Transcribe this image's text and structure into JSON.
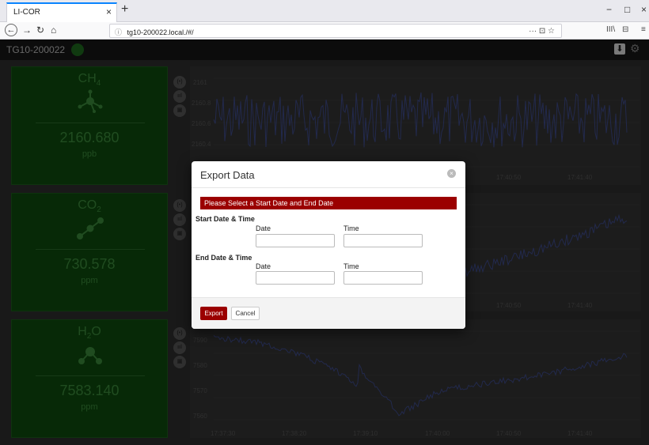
{
  "browser": {
    "tab_title": "LI-COR",
    "tab_close": "×",
    "new_tab": "+",
    "url": "tg10-200022.local./#/",
    "url_info_icon": "info-icon",
    "url_actions": "···  ⊡  ☆",
    "library": "III\\",
    "sidebar_toggle": "⊟",
    "menu": "≡",
    "win_min": "−",
    "win_max": "□",
    "win_close": "×"
  },
  "app": {
    "title": "TG10-200022",
    "status_color": "#1e6a1e",
    "download_icon": "⬇",
    "settings_icon": "⚙"
  },
  "cards": [
    {
      "gas": "CH",
      "sub": "4",
      "value": "2160.680",
      "unit": "ppb"
    },
    {
      "gas": "CO",
      "sub": "2",
      "value": "730.578",
      "unit": "ppm"
    },
    {
      "gas": "H",
      "sub": "2",
      "gas_suffix": "O",
      "value": "7583.140",
      "unit": "ppm"
    }
  ],
  "side_icons": [
    "(•)",
    "ııl",
    "▣"
  ],
  "charts": [
    {
      "y_ticks": [
        "2161",
        "2160.8",
        "2160.6",
        "2160.4"
      ],
      "x_ticks": [
        "17:40:50",
        "17:41:40"
      ]
    },
    {
      "y_ticks": [],
      "x_ticks": [
        "17:40:50",
        "17:41:40"
      ]
    },
    {
      "y_ticks": [
        "7590",
        "7580",
        "7570",
        "7560"
      ],
      "x_ticks": [
        "17:37:30",
        "17:38:20",
        "17:39:10",
        "17:40:00",
        "17:40:50",
        "17:41:40"
      ]
    }
  ],
  "modal": {
    "title": "Export Data",
    "close_icon": "×",
    "alert": "Please Select a Start Date and End Date",
    "start_label": "Start Date & Time",
    "end_label": "End Date & Time",
    "date_label": "Date",
    "time_label": "Time",
    "start_date": "",
    "start_time": "",
    "end_date": "",
    "end_time": "",
    "export_label": "Export",
    "cancel_label": "Cancel"
  },
  "colors": {
    "accent": "#9b0000",
    "card_bg": "#0d4a0d",
    "line": "#3d4a8a"
  }
}
